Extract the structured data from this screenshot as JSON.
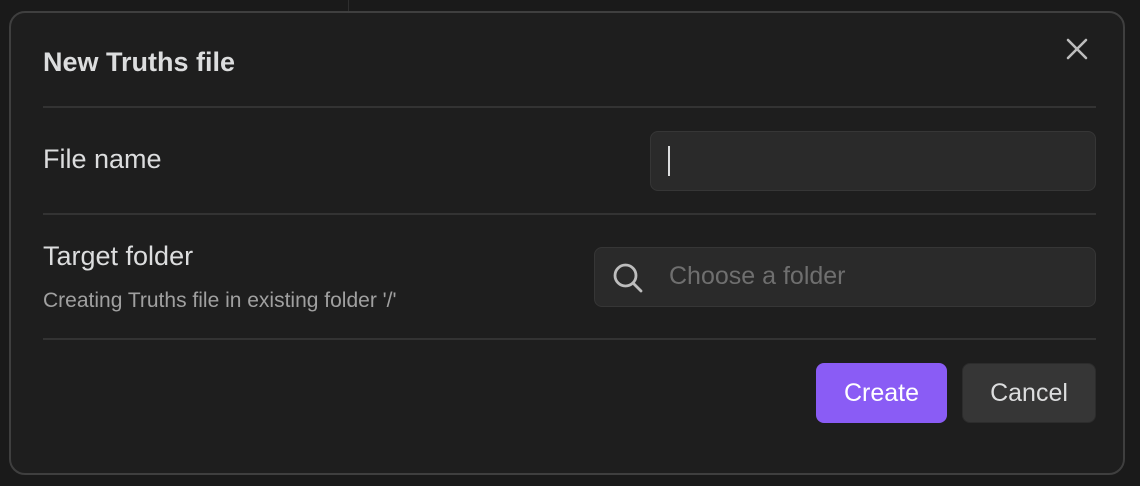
{
  "dialog": {
    "title": "New Truths file"
  },
  "file_name": {
    "label": "File name",
    "value": ""
  },
  "target_folder": {
    "label": "Target folder",
    "description": "Creating Truths file in existing folder '/'",
    "placeholder": "Choose a folder",
    "icon": "search-icon"
  },
  "actions": {
    "create_label": "Create",
    "cancel_label": "Cancel"
  },
  "icons": {
    "close": "close-icon"
  },
  "colors": {
    "accent": "#8a5cf5",
    "background": "#1e1e1e",
    "input_background": "#2a2a2a",
    "text": "#dcddde",
    "muted_text": "#a0a0a0"
  }
}
